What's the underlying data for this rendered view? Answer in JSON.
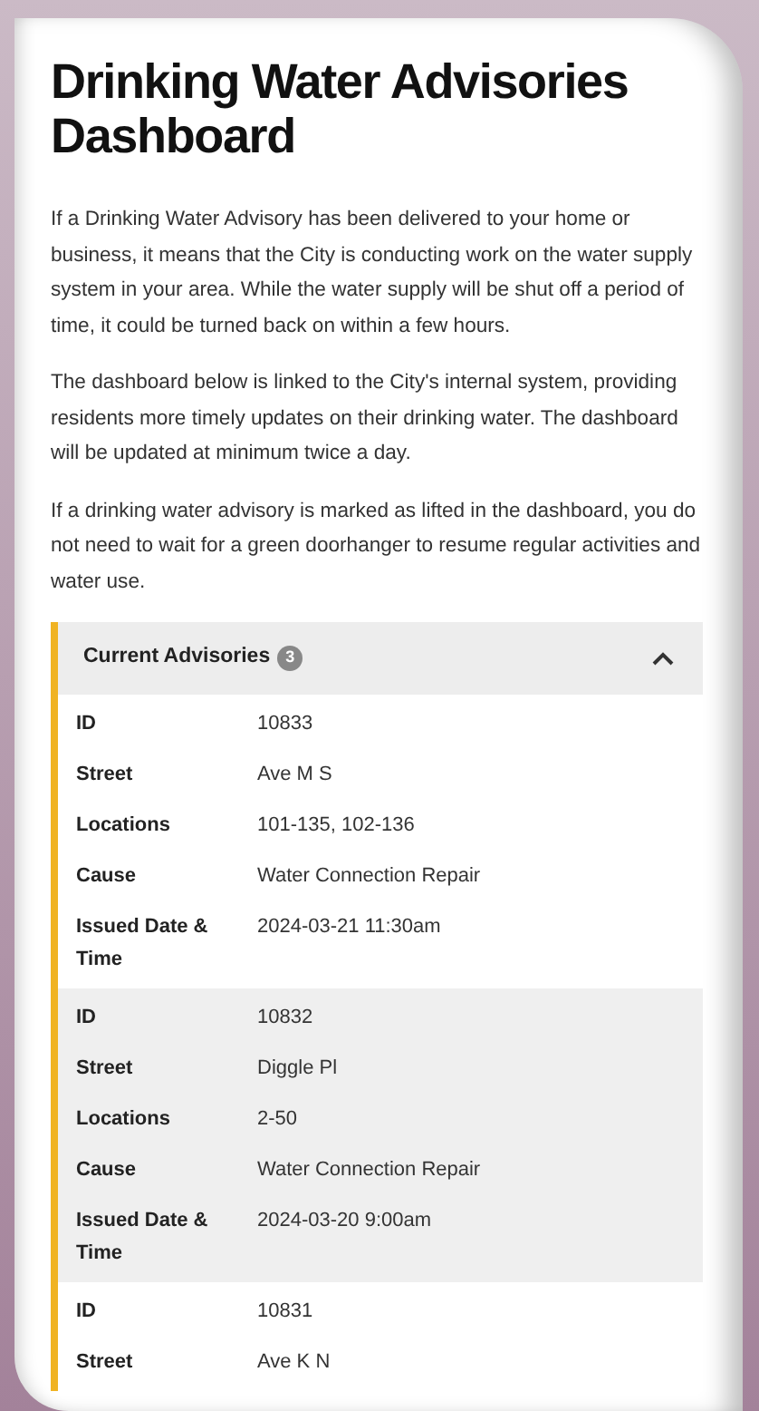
{
  "title": "Drinking Water Advisories Dashboard",
  "paragraphs": [
    "If a Drinking Water Advisory has been delivered to your home or business, it means that the City is conducting work on the water supply system in your area. While the water supply will be shut off a period of time, it could be turned back on within a few hours.",
    "The dashboard below is linked to the City's internal system, providing residents more timely updates on their drinking water. The dashboard will be updated at minimum twice a day.",
    "If a drinking water advisory is marked as lifted in the dashboard, you do not need to wait for a green doorhanger to resume regular activities and water use."
  ],
  "accordion": {
    "title": "Current Advisories",
    "count": "3",
    "expanded": true,
    "advisories": [
      {
        "fields": [
          {
            "label": "ID",
            "value": "10833"
          },
          {
            "label": "Street",
            "value": "Ave M S"
          },
          {
            "label": "Locations",
            "value": "101-135, 102-136"
          },
          {
            "label": "Cause",
            "value": "Water Connection Repair"
          },
          {
            "label": "Issued Date & Time",
            "value": "2024-03-21 11:30am"
          }
        ]
      },
      {
        "fields": [
          {
            "label": "ID",
            "value": "10832"
          },
          {
            "label": "Street",
            "value": "Diggle Pl"
          },
          {
            "label": "Locations",
            "value": "2-50"
          },
          {
            "label": "Cause",
            "value": "Water Connection Repair"
          },
          {
            "label": "Issued Date & Time",
            "value": "2024-03-20 9:00am"
          }
        ]
      },
      {
        "fields": [
          {
            "label": "ID",
            "value": "10831"
          },
          {
            "label": "Street",
            "value": "Ave K N"
          }
        ]
      }
    ]
  }
}
